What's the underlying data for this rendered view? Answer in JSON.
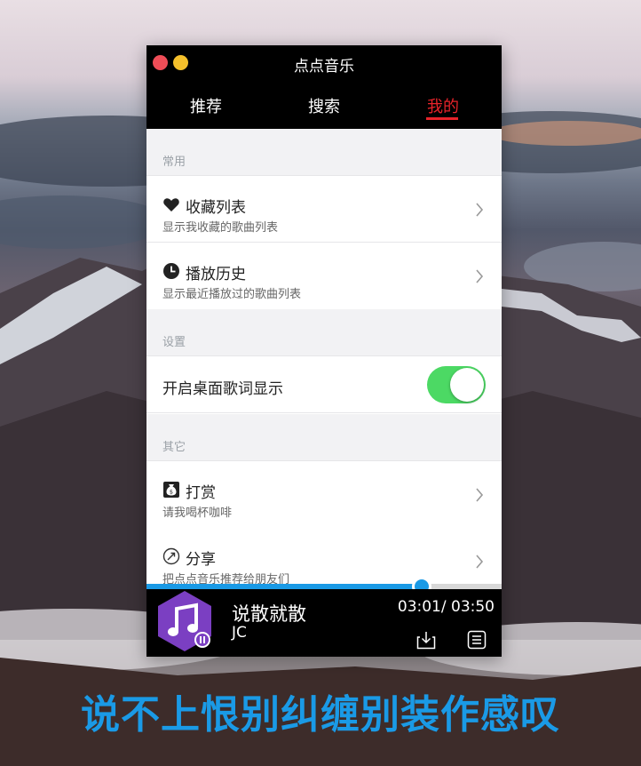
{
  "window": {
    "title": "点点音乐"
  },
  "tabs": [
    {
      "label": "推荐"
    },
    {
      "label": "搜索"
    },
    {
      "label": "我的",
      "active": true
    }
  ],
  "sections": {
    "common": "常用",
    "settings": "设置",
    "other": "其它"
  },
  "rows": {
    "favorites": {
      "icon": "heart-icon",
      "title": "收藏列表",
      "subtitle": "显示我收藏的歌曲列表"
    },
    "history": {
      "icon": "clock-icon",
      "title": "播放历史",
      "subtitle": "显示最近播放过的歌曲列表"
    },
    "reward": {
      "icon": "money-bag-icon",
      "title": "打赏",
      "subtitle": "请我喝杯咖啡"
    },
    "share": {
      "icon": "share-icon",
      "title": "分享",
      "subtitle": "把点点音乐推荐给朋友们"
    }
  },
  "desktop_lyrics": {
    "label": "开启桌面歌词显示",
    "enabled": true
  },
  "player": {
    "song": "说散就散",
    "artist": "JC",
    "time": "03:01/ 03:50",
    "progress": 0.775
  },
  "lyric_overlay": "说不上恨别纠缠别装作感叹",
  "colors": {
    "accent_red": "#e8232a",
    "accent_blue": "#1a9ae6",
    "toggle_on": "#4cd964",
    "cover_purple": "#7b3fc2"
  }
}
